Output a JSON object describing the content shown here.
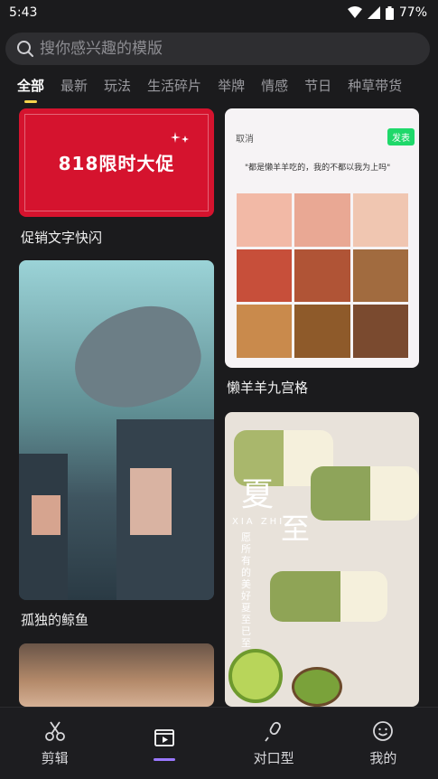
{
  "status": {
    "time": "5:43",
    "battery": "77%"
  },
  "search": {
    "placeholder": "搜你感兴趣的模版"
  },
  "tabs": [
    "全部",
    "最新",
    "玩法",
    "生活碎片",
    "举牌",
    "情感",
    "节日",
    "种草带货"
  ],
  "cards": [
    {
      "title": "促销文字快闪",
      "banner_text": "818限时大促"
    },
    {
      "title": "懒羊羊九宫格",
      "cancel": "取消",
      "publish": "发表",
      "caption": "\"都是懒羊羊吃的，我的不都以我为上吗\""
    },
    {
      "title": "孤独的鲸鱼"
    },
    {
      "title": "",
      "big1": "夏",
      "big2": "至",
      "sub": "XIA ZHI",
      "poem": "愿所有的美好夏至已至"
    }
  ],
  "nav": [
    "剪辑",
    "",
    "对口型",
    "我的"
  ],
  "colors": {
    "accent_tab": "#f4d44d",
    "nav_accent": "#9a78ff",
    "publish_green": "#1fd86a",
    "promo_red": "#d5132e"
  }
}
